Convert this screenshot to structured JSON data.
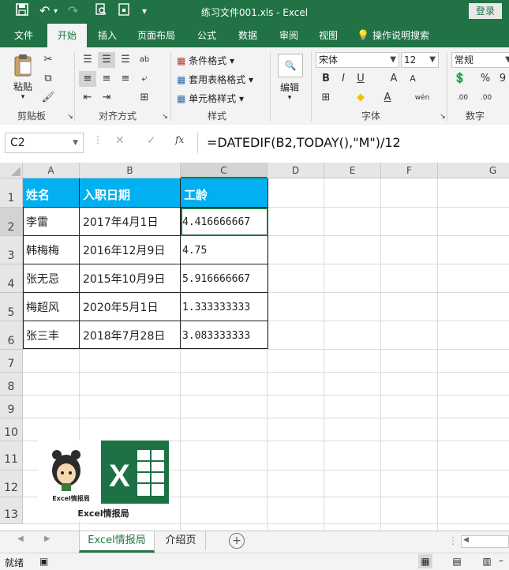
{
  "window": {
    "title": "练习文件001.xls - Excel",
    "login": "登录"
  },
  "tabs": [
    "文件",
    "开始",
    "插入",
    "页面布局",
    "公式",
    "数据",
    "审阅",
    "视图"
  ],
  "active_tab": "开始",
  "tell_me": "操作说明搜索",
  "ribbon": {
    "clipboard": {
      "paste": "粘贴",
      "label": "剪贴板"
    },
    "alignment": {
      "label": "对齐方式"
    },
    "styles": {
      "conditional": "条件格式",
      "table_format": "套用表格格式",
      "cell_styles": "单元格样式",
      "label": "样式"
    },
    "editing": {
      "label": "编辑"
    },
    "font": {
      "name": "宋体",
      "size": "12",
      "bold": "B",
      "italic": "I",
      "underline": "U",
      "grow": "A",
      "shrink": "A",
      "wen": "wén",
      "label": "字体"
    },
    "number": {
      "format": "常规",
      "percent": "%",
      "comma": "9",
      "inc": ".00",
      "dec": ".00",
      "label": "数字"
    }
  },
  "formula_bar": {
    "name_box": "C2",
    "formula": "=DATEDIF(B2,TODAY(),\"M\")/12",
    "fx": "fx"
  },
  "sheet": {
    "columns": [
      "A",
      "B",
      "C",
      "D",
      "E",
      "F",
      "G"
    ],
    "rows": [
      "1",
      "2",
      "3",
      "4",
      "5",
      "6",
      "7",
      "8",
      "9",
      "10",
      "11",
      "12",
      "13"
    ],
    "headers": [
      "姓名",
      "入职日期",
      "工龄"
    ],
    "data": [
      [
        "李雷",
        "2017年4月1日",
        "4.416666667"
      ],
      [
        "韩梅梅",
        "2016年12月9日",
        "4.75"
      ],
      [
        "张无忌",
        "2015年10月9日",
        "5.916666667"
      ],
      [
        "梅超风",
        "2020年5月1日",
        "1.333333333"
      ],
      [
        "张三丰",
        "2018年7月28日",
        "3.083333333"
      ]
    ],
    "logo_caption_small": "Excel情报局",
    "logo_caption": "Excel情报局"
  },
  "sheet_tabs": [
    "Excel情报局",
    "介绍页"
  ],
  "active_sheet": "Excel情报局",
  "status": {
    "text": "就绪"
  },
  "colors": {
    "accent": "#217346",
    "header_fill": "#00b0f0"
  }
}
